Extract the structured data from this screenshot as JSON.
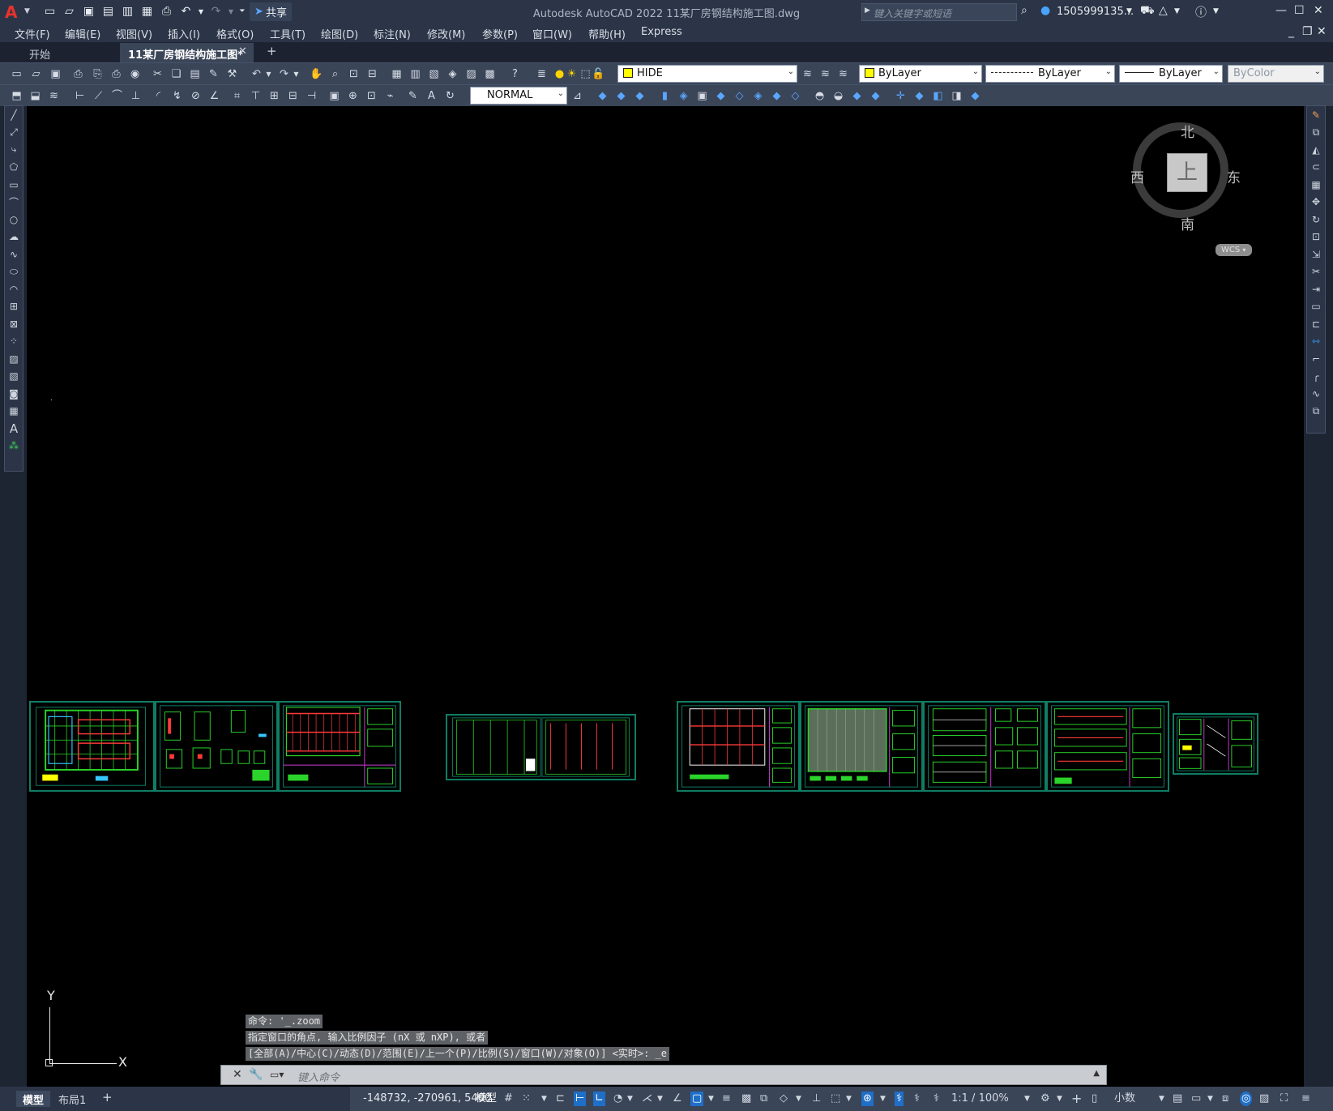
{
  "app": {
    "title": "Autodesk AutoCAD 2022    11某厂房钢结构施工图.dwg",
    "share_label": "共享",
    "search_placeholder": "键入关键字或短语",
    "user": "1505999135...",
    "logo": "A"
  },
  "menus": [
    "文件(F)",
    "编辑(E)",
    "视图(V)",
    "插入(I)",
    "格式(O)",
    "工具(T)",
    "绘图(D)",
    "标注(N)",
    "修改(M)",
    "参数(P)",
    "窗口(W)",
    "帮助(H)",
    "Express"
  ],
  "tabs": {
    "start": "开始",
    "drawing": "11某厂房钢结构施工图*",
    "add": "+"
  },
  "toolbar": {
    "layer": "HIDE",
    "color": "ByLayer",
    "linetype": "ByLayer",
    "lineweight": "ByLayer",
    "plotstyle": "ByColor",
    "dimstyle": "NORMAL"
  },
  "viewcube": {
    "top": "上",
    "north": "北",
    "south": "南",
    "east": "东",
    "west": "西",
    "wcs": "WCS"
  },
  "ucs": {
    "x": "X",
    "y": "Y"
  },
  "command": {
    "history": [
      "命令: '_.zoom",
      "指定窗口的角点, 输入比例因子 (nX 或 nXP), 或者",
      "[全部(A)/中心(C)/动态(D)/范围(E)/上一个(P)/比例(S)/窗口(W)/对象(O)] <实时>: _e"
    ],
    "placeholder": "键入命令"
  },
  "status": {
    "model_tab": "模型",
    "layout_tab": "布局1",
    "coordinates": "-148732, -270961, 5400",
    "space": "模型",
    "scale": "1:1 / 100%",
    "units": "小数"
  },
  "colors": {
    "accent": "#1f6fc8",
    "drawing_green": "#2ad42a",
    "sheet_border": "#0f7d64",
    "layer_swatch": "#ffff00"
  }
}
